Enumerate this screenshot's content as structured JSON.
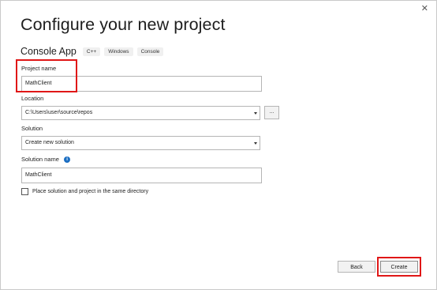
{
  "window": {
    "close_label": "✕"
  },
  "header": {
    "title": "Configure your new project",
    "subtitle": "Console App",
    "tags": [
      "C++",
      "Windows",
      "Console"
    ]
  },
  "form": {
    "project_name": {
      "label": "Project name",
      "value": "MathClient"
    },
    "location": {
      "label": "Location",
      "value": "C:\\Users\\user\\source\\repos",
      "browse_label": "..."
    },
    "solution": {
      "label": "Solution",
      "value": "Create new solution"
    },
    "solution_name": {
      "label": "Solution name",
      "value": "MathClient",
      "info_glyph": "i"
    },
    "same_directory": {
      "label": "Place solution and project in the same directory",
      "checked": false
    }
  },
  "footer": {
    "back_label": "Back",
    "create_label": "Create"
  },
  "colors": {
    "highlight": "#e01717",
    "accent": "#1b6ec2"
  },
  "icons": [
    "close-icon",
    "info-icon",
    "dropdown-caret-icon"
  ]
}
